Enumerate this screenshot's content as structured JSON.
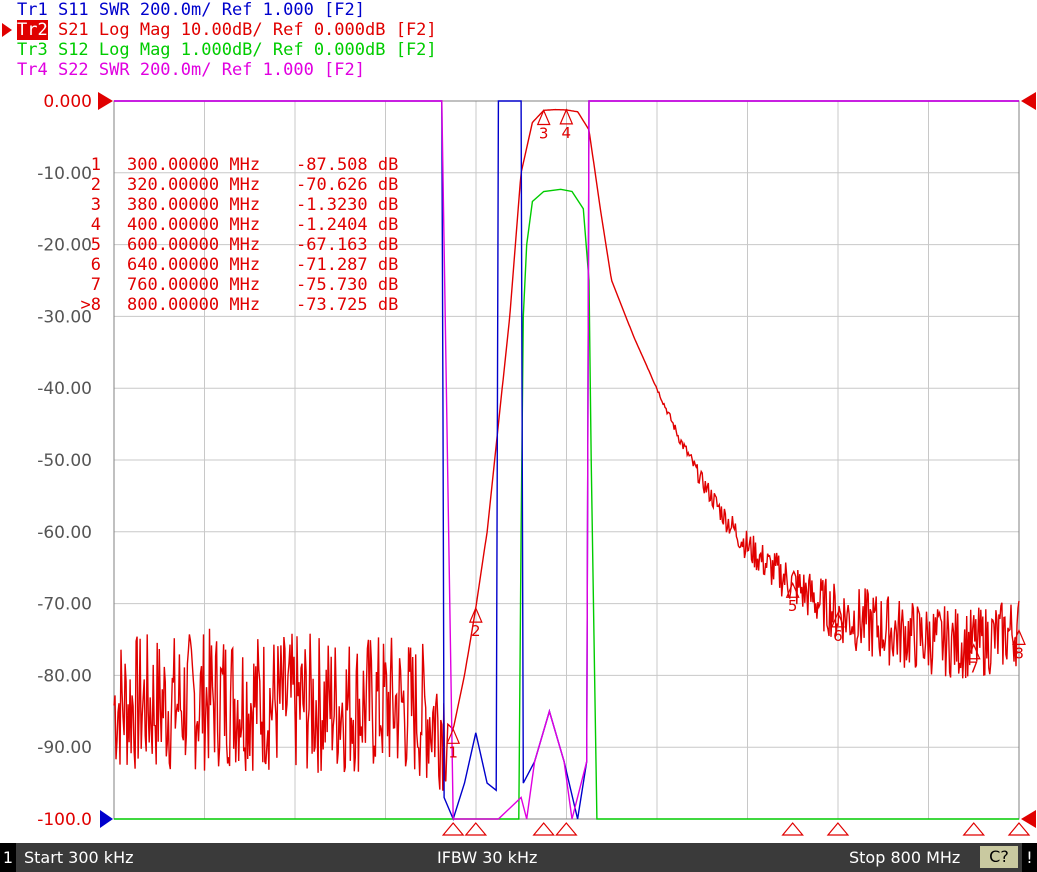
{
  "traces": [
    {
      "id": "Tr1",
      "param": "S11",
      "fmt": "SWR",
      "scale": "200.0m/",
      "ref": "Ref 1.000",
      "tag": "[F2]",
      "color": "#0000cc",
      "active": false
    },
    {
      "id": "Tr2",
      "param": "S21",
      "fmt": "Log Mag",
      "scale": "10.00dB/",
      "ref": "Ref 0.000dB",
      "tag": "[F2]",
      "color": "#e00000",
      "active": true
    },
    {
      "id": "Tr3",
      "param": "S12",
      "fmt": "Log Mag",
      "scale": "1.000dB/",
      "ref": "Ref 0.000dB",
      "tag": "[F2]",
      "color": "#00cc00",
      "active": false
    },
    {
      "id": "Tr4",
      "param": "S22",
      "fmt": "SWR",
      "scale": "200.0m/",
      "ref": "Ref 1.000",
      "tag": "[F2]",
      "color": "#e000e0",
      "active": false
    }
  ],
  "markers": [
    {
      "n": "1",
      "freq": "300.00000 MHz",
      "val": "-87.508 dB",
      "prefix": ""
    },
    {
      "n": "2",
      "freq": "320.00000 MHz",
      "val": "-70.626 dB",
      "prefix": ""
    },
    {
      "n": "3",
      "freq": "380.00000 MHz",
      "val": "-1.3230 dB",
      "prefix": ""
    },
    {
      "n": "4",
      "freq": "400.00000 MHz",
      "val": "-1.2404 dB",
      "prefix": ""
    },
    {
      "n": "5",
      "freq": "600.00000 MHz",
      "val": "-67.163 dB",
      "prefix": ""
    },
    {
      "n": "6",
      "freq": "640.00000 MHz",
      "val": "-71.287 dB",
      "prefix": ""
    },
    {
      "n": "7",
      "freq": "760.00000 MHz",
      "val": "-75.730 dB",
      "prefix": ""
    },
    {
      "n": "8",
      "freq": "800.00000 MHz",
      "val": "-73.725 dB",
      "prefix": ">"
    }
  ],
  "status": {
    "channel": "1",
    "start": "Start 300 kHz",
    "ifbw": "IFBW 30 kHz",
    "stop": "Stop 800 MHz",
    "cal": "C?",
    "excl": "!"
  },
  "chart_data": {
    "type": "line",
    "x_unit": "MHz",
    "xlim": [
      0.3,
      800
    ],
    "ylim": [
      -100,
      0
    ],
    "yticks": [
      "0.000",
      "-10.00",
      "-20.00",
      "-30.00",
      "-40.00",
      "-50.00",
      "-60.00",
      "-70.00",
      "-80.00",
      "-90.00",
      "-100.0"
    ],
    "grid": true,
    "series": [
      {
        "name": "S21",
        "color": "#e00000",
        "points": [
          [
            0.3,
            -84
          ],
          [
            50,
            -84
          ],
          [
            100,
            -83
          ],
          [
            150,
            -84
          ],
          [
            200,
            -84
          ],
          [
            250,
            -84
          ],
          [
            290,
            -86
          ],
          [
            300,
            -87.5
          ],
          [
            310,
            -80
          ],
          [
            320,
            -70.6
          ],
          [
            330,
            -60
          ],
          [
            340,
            -45
          ],
          [
            350,
            -30
          ],
          [
            360,
            -10
          ],
          [
            370,
            -3
          ],
          [
            380,
            -1.3
          ],
          [
            390,
            -1.2
          ],
          [
            400,
            -1.24
          ],
          [
            410,
            -1.5
          ],
          [
            420,
            -4
          ],
          [
            430,
            -15
          ],
          [
            440,
            -25
          ],
          [
            460,
            -33
          ],
          [
            480,
            -40
          ],
          [
            500,
            -47
          ],
          [
            520,
            -53
          ],
          [
            540,
            -58
          ],
          [
            560,
            -62
          ],
          [
            580,
            -65
          ],
          [
            600,
            -67.2
          ],
          [
            620,
            -69.5
          ],
          [
            640,
            -71.3
          ],
          [
            680,
            -73.5
          ],
          [
            720,
            -75
          ],
          [
            760,
            -75.7
          ],
          [
            800,
            -73.7
          ]
        ]
      },
      {
        "name": "S12",
        "color": "#00cc00",
        "points": [
          [
            0.3,
            -100
          ],
          [
            358,
            -100
          ],
          [
            360,
            -60
          ],
          [
            362,
            -30
          ],
          [
            365,
            -20
          ],
          [
            370,
            -14
          ],
          [
            380,
            -12.6
          ],
          [
            395,
            -12.3
          ],
          [
            405,
            -12.6
          ],
          [
            415,
            -15
          ],
          [
            420,
            -25
          ],
          [
            422,
            -50
          ],
          [
            425,
            -80
          ],
          [
            427,
            -100
          ],
          [
            800,
            -100
          ]
        ]
      },
      {
        "name": "S11",
        "color": "#0000cc",
        "points": [
          [
            0.3,
            0
          ],
          [
            290,
            0
          ],
          [
            291,
            -44
          ],
          [
            292,
            -97
          ],
          [
            300,
            -100
          ],
          [
            310,
            -95
          ],
          [
            320,
            -88
          ],
          [
            330,
            -95
          ],
          [
            338,
            -96
          ],
          [
            340,
            0
          ],
          [
            360,
            0
          ],
          [
            362,
            -95
          ],
          [
            372,
            -92
          ],
          [
            385,
            -85
          ],
          [
            398,
            -92
          ],
          [
            410,
            -100
          ],
          [
            418,
            -92
          ],
          [
            420,
            0
          ],
          [
            800,
            0
          ]
        ]
      },
      {
        "name": "S22",
        "color": "#e000e0",
        "points": [
          [
            0.3,
            0
          ],
          [
            290,
            0
          ],
          [
            300,
            -100
          ],
          [
            320,
            -100
          ],
          [
            340,
            -100
          ],
          [
            360,
            -97
          ],
          [
            365,
            -100
          ],
          [
            372,
            -92
          ],
          [
            385,
            -85
          ],
          [
            398,
            -92
          ],
          [
            405,
            -100
          ],
          [
            418,
            -92
          ],
          [
            420,
            0
          ],
          [
            800,
            0
          ]
        ]
      }
    ],
    "marker_values": [
      {
        "n": "1",
        "x": 300,
        "y": -87.508
      },
      {
        "n": "2",
        "x": 320,
        "y": -70.626
      },
      {
        "n": "3",
        "x": 380,
        "y": -1.323
      },
      {
        "n": "4",
        "x": 400,
        "y": -1.2404
      },
      {
        "n": "5",
        "x": 600,
        "y": -67.163
      },
      {
        "n": "6",
        "x": 640,
        "y": -71.287
      },
      {
        "n": "7",
        "x": 760,
        "y": -75.73
      },
      {
        "n": "8",
        "x": 800,
        "y": -73.725
      }
    ]
  }
}
